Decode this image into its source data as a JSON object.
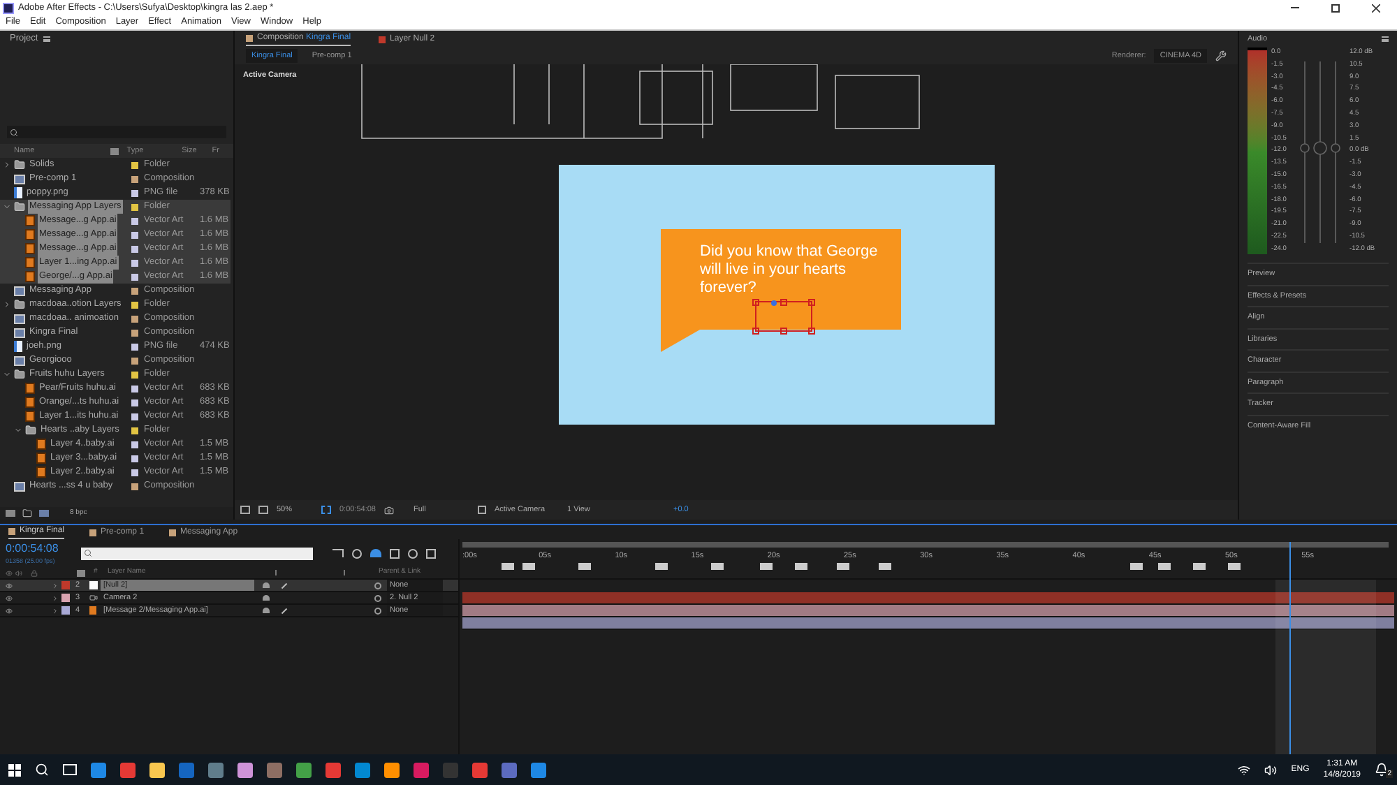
{
  "window": {
    "title": "Adobe After Effects - C:\\Users\\Sufya\\Desktop\\kingra las 2.aep *"
  },
  "menu": [
    "File",
    "Edit",
    "Composition",
    "Layer",
    "Effect",
    "Animation",
    "View",
    "Window",
    "Help"
  ],
  "project": {
    "title": "Project",
    "columns": [
      "Name",
      "Type",
      "Size",
      "Fr"
    ],
    "bit_depth": "8 bpc",
    "items": [
      {
        "name": "Solids",
        "kind": "folder",
        "type": "Folder",
        "selected": false,
        "expanded": false
      },
      {
        "name": "Pre-comp 1",
        "kind": "composition",
        "type": "Composition",
        "selected": false
      },
      {
        "name": "poppy.png",
        "kind": "png",
        "type": "PNG file",
        "size": "378 KB",
        "selected": false
      },
      {
        "name": "Messaging App Layers",
        "kind": "folder",
        "type": "Folder",
        "selected": true,
        "expanded": true,
        "children": [
          {
            "name": "Message...g App.ai",
            "kind": "vector",
            "type": "Vector Art",
            "size": "1.6 MB",
            "selected": true
          },
          {
            "name": "Message...g App.ai",
            "kind": "vector",
            "type": "Vector Art",
            "size": "1.6 MB",
            "selected": true
          },
          {
            "name": "Message...g App.ai",
            "kind": "vector",
            "type": "Vector Art",
            "size": "1.6 MB",
            "selected": true
          },
          {
            "name": "Layer 1...ing App.ai",
            "kind": "vector",
            "type": "Vector Art",
            "size": "1.6 MB",
            "selected": true
          },
          {
            "name": "George/...g App.ai",
            "kind": "vector",
            "type": "Vector Art",
            "size": "1.6 MB",
            "selected": true
          }
        ]
      },
      {
        "name": "Messaging App",
        "kind": "composition",
        "type": "Composition",
        "selected": false
      },
      {
        "name": "macdoaa..otion Layers",
        "kind": "folder",
        "type": "Folder",
        "selected": false,
        "expanded": false
      },
      {
        "name": "macdoaa.. animoation",
        "kind": "composition",
        "type": "Composition",
        "selected": false
      },
      {
        "name": "Kingra Final",
        "kind": "composition",
        "type": "Composition",
        "selected": false
      },
      {
        "name": "joeh.png",
        "kind": "png",
        "type": "PNG file",
        "size": "474 KB",
        "selected": false
      },
      {
        "name": "Georgiooo",
        "kind": "composition",
        "type": "Composition",
        "selected": false
      },
      {
        "name": "Fruits huhu Layers",
        "kind": "folder",
        "type": "Folder",
        "selected": false,
        "expanded": true,
        "children": [
          {
            "name": "Pear/Fruits huhu.ai",
            "kind": "vector",
            "type": "Vector Art",
            "size": "683 KB",
            "selected": false
          },
          {
            "name": "Orange/...ts huhu.ai",
            "kind": "vector",
            "type": "Vector Art",
            "size": "683 KB",
            "selected": false
          },
          {
            "name": "Layer 1...its huhu.ai",
            "kind": "vector",
            "type": "Vector Art",
            "size": "683 KB",
            "selected": false
          },
          {
            "name": "Hearts ..aby Layers",
            "kind": "folder",
            "type": "Folder",
            "selected": false,
            "expanded": true,
            "children": [
              {
                "name": "Layer 4..baby.ai",
                "kind": "vector",
                "type": "Vector Art",
                "size": "1.5 MB",
                "selected": false
              },
              {
                "name": "Layer 3...baby.ai",
                "kind": "vector",
                "type": "Vector Art",
                "size": "1.5 MB",
                "selected": false
              },
              {
                "name": "Layer 2..baby.ai",
                "kind": "vector",
                "type": "Vector Art",
                "size": "1.5 MB",
                "selected": false
              }
            ]
          }
        ]
      },
      {
        "name": "Hearts ...ss 4 u baby",
        "kind": "composition",
        "type": "Composition",
        "selected": false
      }
    ]
  },
  "composition": {
    "tabs": [
      {
        "prefix": "Composition",
        "name": "Kingra Final",
        "selected": true
      },
      {
        "prefix": "Layer",
        "name": "Null 2",
        "selected": false
      }
    ],
    "breadcrumbs": [
      {
        "label": "Kingra Final",
        "selected": true
      },
      {
        "label": "Pre-comp 1",
        "selected": false
      }
    ],
    "renderer_label": "Renderer:",
    "renderer": "CINEMA 4D",
    "view_label": "Active Camera",
    "bubble_text": "Did you know that George will live in your hearts forever?",
    "toolbar": {
      "zoom": "50%",
      "time": "0:00:54:08",
      "resolution": "Full",
      "camera": "Active Camera",
      "views": "1 View",
      "exposure": "+0.0"
    }
  },
  "audio": {
    "title": "Audio",
    "meter_scale": [
      "0.0",
      "-1.5",
      "-3.0",
      "-4.5",
      "-6.0",
      "-7.5",
      "-9.0",
      "-10.5",
      "-12.0",
      "-13.5",
      "-15.0",
      "-16.5",
      "-18.0",
      "-19.5",
      "-21.0",
      "-22.5",
      "-24.0"
    ],
    "db_scale": [
      "12.0 dB",
      "10.5",
      "9.0",
      "7.5",
      "6.0",
      "4.5",
      "3.0",
      "1.5",
      "0.0 dB",
      "-1.5",
      "-3.0",
      "-4.5",
      "-6.0",
      "-7.5",
      "-9.0",
      "-10.5",
      "-12.0 dB"
    ]
  },
  "panels": [
    "Preview",
    "Effects & Presets",
    "Align",
    "Libraries",
    "Character",
    "Paragraph",
    "Tracker",
    "Content-Aware Fill"
  ],
  "timeline": {
    "tabs": [
      {
        "label": "Kingra Final",
        "selected": true
      },
      {
        "label": "Pre-comp 1",
        "selected": false
      },
      {
        "label": "Messaging App",
        "selected": false
      }
    ],
    "timecode": "0:00:54:08",
    "frames": "01358 (25.00 fps)",
    "columns": [
      "#",
      "Layer Name",
      "Parent & Link"
    ],
    "layers": [
      {
        "number": "2",
        "name": "[Null 2]",
        "kind": "null",
        "color": "#c0392b",
        "parent": "None",
        "selected": true
      },
      {
        "number": "3",
        "name": "Camera 2",
        "kind": "camera",
        "color": "#d9a3b0",
        "parent": "2. Null 2",
        "selected": false
      },
      {
        "number": "4",
        "name": "[Message 2/Messaging App.ai]",
        "kind": "vector",
        "color": "#a9a9d6",
        "parent": "None",
        "selected": false
      }
    ],
    "ruler": [
      ":00s",
      "05s",
      "10s",
      "15s",
      "20s",
      "25s",
      "30s",
      "35s",
      "40s",
      "45s",
      "50s",
      "55s"
    ]
  },
  "taskbar": {
    "language": "ENG",
    "time": "1:31 AM",
    "date": "14/8/2019",
    "notifications": "2"
  }
}
